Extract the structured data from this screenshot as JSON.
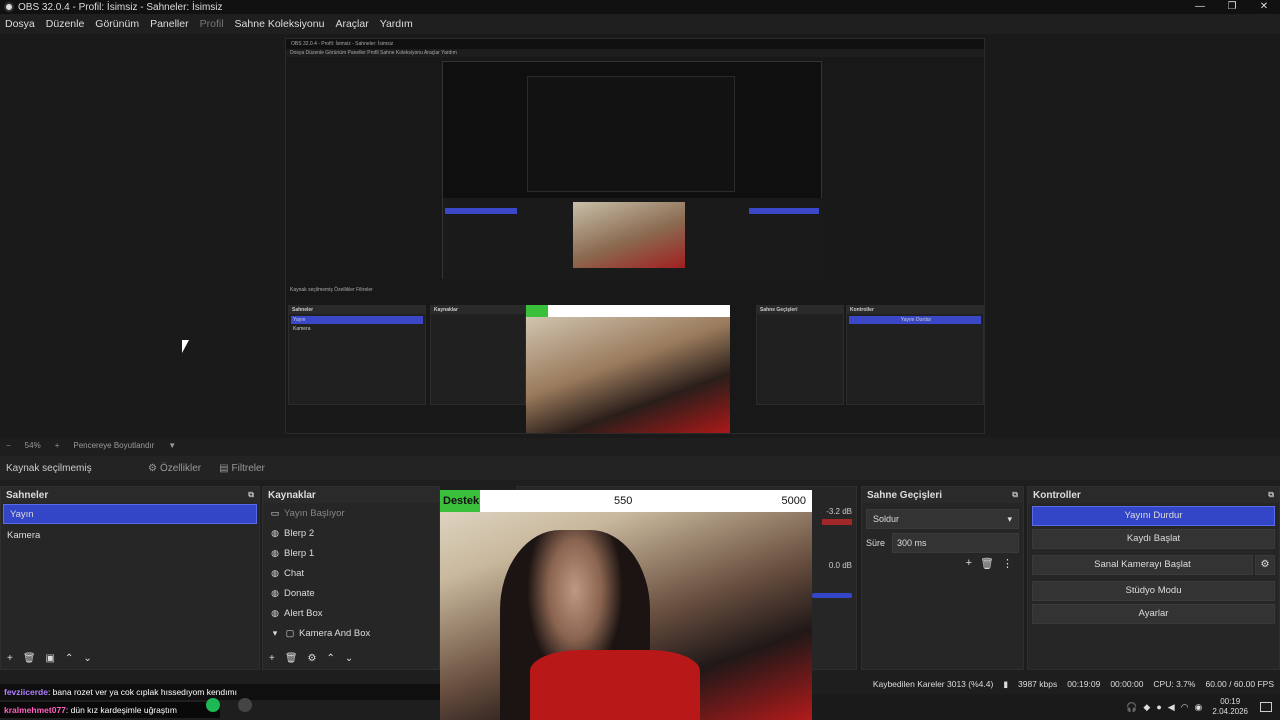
{
  "window": {
    "title": "OBS 32.0.4 - Profil: İsimsiz - Sahneler: İsimsiz",
    "controls": [
      "—",
      "❐",
      "✕"
    ]
  },
  "menu": {
    "items": [
      "Dosya",
      "Düzenle",
      "Görünüm",
      "Paneller",
      "Profil",
      "Sahne Koleksiyonu",
      "Araçlar",
      "Yardım"
    ]
  },
  "nested_preview": {
    "title": "OBS 32.0.4 - Profil: İsimsiz - Sahneler: İsimsiz",
    "menu": "Dosya  Düzenle  Görünüm  Paneller  Profil  Sahne Koleksiyonu  Araçlar  Yardım",
    "tools": "Kaynak seçilmemiş     Özellikler     Filtreler",
    "scenes_header": "Sahneler",
    "scene_selected": "Yayın",
    "scene_2": "Kamera",
    "sources_header": "Kaynaklar",
    "transitions_header": "Sahne Geçişleri",
    "controls_header": "Kontroller",
    "btn_stop": "Yayını Durdur"
  },
  "zoom": {
    "minus": "−",
    "value": "54%",
    "plus": "+",
    "mode": "Pencereye Boyutlandır",
    "arrow": "▼"
  },
  "source_toolbar": {
    "no_source": "Kaynak seçilmemiş",
    "properties": "Özellikler",
    "filters": "Filtreler"
  },
  "scenes": {
    "header": "Sahneler",
    "items": [
      "Yayın",
      "Kamera"
    ]
  },
  "sources": {
    "header": "Kaynaklar",
    "items": [
      "Yayın Başlıyor",
      "Blerp 2",
      "Blerp 1",
      "Chat",
      "Donate",
      "Alert Box",
      "Kamera And Box"
    ]
  },
  "mixer": {
    "db1": "-3.2 dB",
    "db2": "0.0 dB"
  },
  "webcam_overlay": {
    "label": "Destek",
    "current": "550",
    "goal": "5000"
  },
  "transitions": {
    "header": "Sahne Geçişleri",
    "transition": "Soldur",
    "duration_label": "Süre",
    "duration_value": "300 ms"
  },
  "controls": {
    "header": "Kontroller",
    "stop_stream": "Yayını Durdur",
    "start_recording": "Kaydı Başlat",
    "virtual_camera": "Sanal Kamerayı Başlat",
    "studio_mode": "Stüdyo Modu",
    "settings": "Ayarlar"
  },
  "chat": {
    "user1": "fevziicerde",
    "msg1": ": bana rozet ver ya cok cıplak hıssedıyom kendımı",
    "user2": "kralmehmet077",
    "msg2": ": dün kız kardeşimle uğraştım"
  },
  "status": {
    "dropped": "Kaybedilen Kareler 3013 (%4.4)",
    "bitrate": "3987 kbps",
    "stream_time": "00:19:09",
    "rec_time": "00:00:00",
    "cpu": "CPU: 3.7%",
    "fps": "60.00 / 60.00 FPS"
  },
  "clock": {
    "time": "00:19",
    "date": "2.04.2026"
  },
  "colors": {
    "accent": "#3446c8",
    "panel": "#262626",
    "background": "#1e1e1e",
    "goal_green": "#3ac03a"
  }
}
